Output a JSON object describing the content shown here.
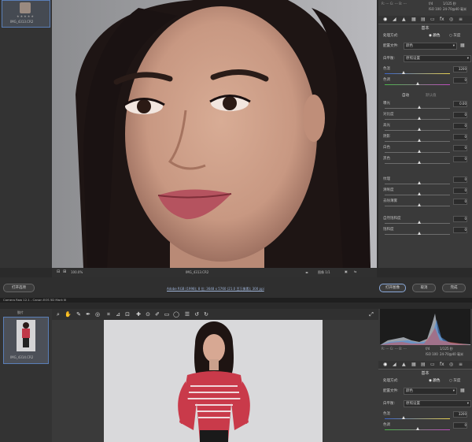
{
  "top": {
    "filmstrip_thumb_label": "IMG_4313.CR2",
    "zoom_value": "100.0%",
    "status_filename": "IMG_4313.CR2",
    "workflow_info": "Adobe RGB (1998); 8 位; 3648 x 5760 (21.0 百万像素); 300 ppi",
    "page_indicator": "图像 1/1",
    "button_select": "打开选项",
    "button_open": "打开图像",
    "button_cancel": "取消",
    "button_done": "完成",
    "panel": {
      "header_label": "基本",
      "mode_label": "处理方式:",
      "mode_color": "颜色",
      "mode_gray": "灰度",
      "profile_label": "配置文件:",
      "profile_value": "颜色",
      "wb_label": "白平衡:",
      "wb_value": "原照设置",
      "temp_label": "色温",
      "temp_value": "3200",
      "tint_label": "色调",
      "tint_value": "0",
      "auto_label": "自动",
      "default_label": "默认值",
      "sliders": [
        {
          "label": "曝光",
          "value": "0.00"
        },
        {
          "label": "对比度",
          "value": "0"
        },
        {
          "label": "高光",
          "value": "0"
        },
        {
          "label": "阴影",
          "value": "0"
        },
        {
          "label": "白色",
          "value": "0"
        },
        {
          "label": "黑色",
          "value": "0"
        },
        {
          "label": "纹理",
          "value": "0"
        },
        {
          "label": "清晰度",
          "value": "0"
        },
        {
          "label": "去除薄雾",
          "value": "0"
        },
        {
          "label": "自然饱和度",
          "value": "0"
        },
        {
          "label": "饱和度",
          "value": "0"
        }
      ],
      "cam_info_1": "f/4",
      "cam_info_2": "1/125 秒",
      "cam_info_3": "ISO 100",
      "cam_info_4": "24-70@40 毫米"
    }
  },
  "bottom": {
    "title_bar": "Camera Raw 12.1 - Canon EOS 5D Mark III",
    "filmstrip_header": "胶片",
    "filmstrip_thumb_label": "IMG_4314.CR2",
    "cam_info_1": "f/4",
    "cam_info_2": "1/125 秒",
    "cam_info_3": "ISO 100",
    "cam_info_4": "24-70@40 毫米",
    "panel": {
      "header_label": "基本",
      "mode_label": "处理方式:",
      "mode_color": "颜色",
      "mode_gray": "灰度",
      "profile_label": "配置文件:",
      "profile_value": "颜色",
      "wb_label": "白平衡:",
      "wb_value": "原照设置",
      "temp_label": "色温",
      "temp_value": "3200",
      "tint_label": "色调",
      "tint_value": "0"
    }
  },
  "colors": {
    "app_bg": "#2a2a2a",
    "panel_bg": "#3a3a3a",
    "selection": "#5a7fb8",
    "canvas_bg": "#d9d9db"
  }
}
